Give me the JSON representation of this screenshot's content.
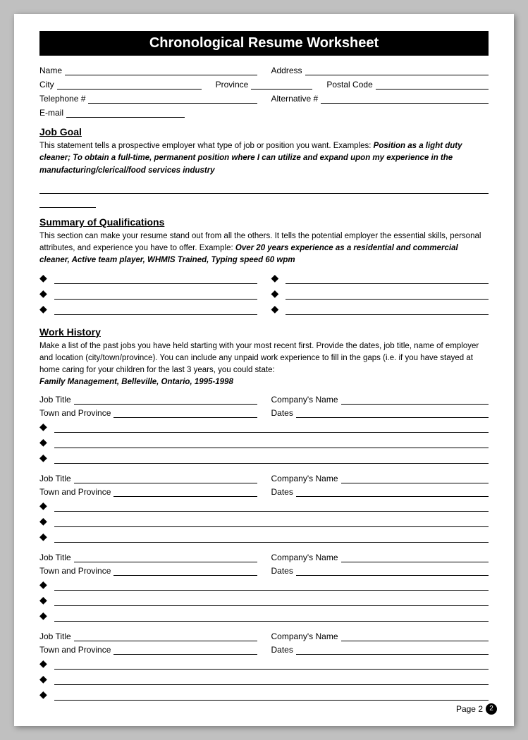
{
  "header": {
    "title": "Chronological Resume Worksheet"
  },
  "personal_fields": {
    "name_label": "Name",
    "address_label": "Address",
    "city_label": "City",
    "province_label": "Province",
    "postal_code_label": "Postal Code",
    "telephone_label": "Telephone #",
    "alternative_label": "Alternative #",
    "email_label": "E-mail"
  },
  "job_goal": {
    "title": "Job Goal",
    "body": "This statement tells a prospective employer what type of job or position you want. Examples: ",
    "example": "Position as a light duty cleaner; To obtain a full-time, permanent position where I can utilize and expand upon my experience in the manufacturing/clerical/food services industry"
  },
  "summary": {
    "title": "Summary of Qualifications",
    "body": "This section can make your resume stand out from all the others. It tells the potential employer the essential skills, personal attributes, and experience you have to offer. Example: ",
    "example": "Over 20 years experience as a residential and commercial cleaner, Active team player, WHMIS Trained, Typing speed 60 wpm"
  },
  "work_history": {
    "title": "Work History",
    "body": "Make a list of the past jobs you have held starting with your most recent first.  Provide the dates, job title, name of employer and location (city/town/province).  You can include any unpaid work experience to fill in the gaps (i.e. if you have stayed at home caring for your children for the last 3 years, you could state:",
    "example": "Family Management, Belleville, Ontario, 1995-1998",
    "job_title_label": "Job Title",
    "company_label": "Company's Name",
    "town_label": "Town and Province",
    "dates_label": "Dates"
  },
  "footer": {
    "page_label": "Page 2",
    "page_number": "2"
  }
}
